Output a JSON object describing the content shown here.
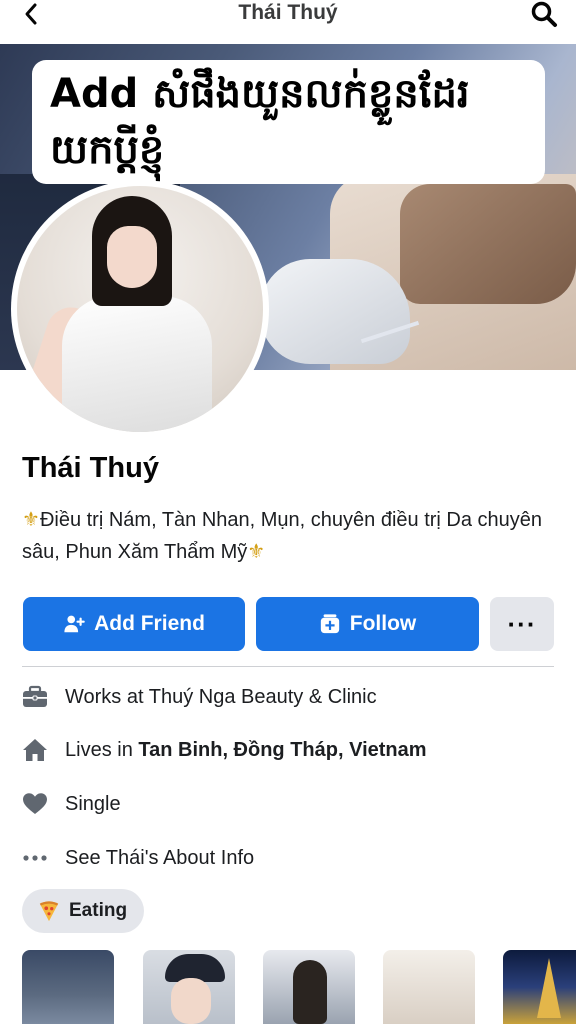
{
  "header": {
    "title": "Thái Thuý"
  },
  "cover": {
    "caption_line1": "Add សំផឹងយួនលក់ខ្លួនដែរ",
    "caption_line2": "យកប្ដីខ្ញុំ"
  },
  "profile": {
    "name": "Thái Thuý",
    "bio_fleur": "⚜",
    "bio_text": "Điều trị Nám, Tàn Nhan, Mụn, chuyên điều trị Da chuyên sâu, Phun Xăm Thẩm Mỹ"
  },
  "actions": {
    "add_friend": "Add Friend",
    "follow": "Follow",
    "more": "···"
  },
  "info": {
    "work": "Works at Thuý Nga Beauty & Clinic",
    "lives_prefix": "Lives in ",
    "lives_place": "Tan Binh, Đồng Tháp, Vietnam",
    "relationship": "Single",
    "about_link": "See Thái's About Info"
  },
  "hobby": {
    "label": "Eating",
    "icon": "pizza-icon"
  },
  "colors": {
    "accent": "#1b74e4",
    "secondary_button": "#e4e6eb",
    "icon": "#606770"
  }
}
